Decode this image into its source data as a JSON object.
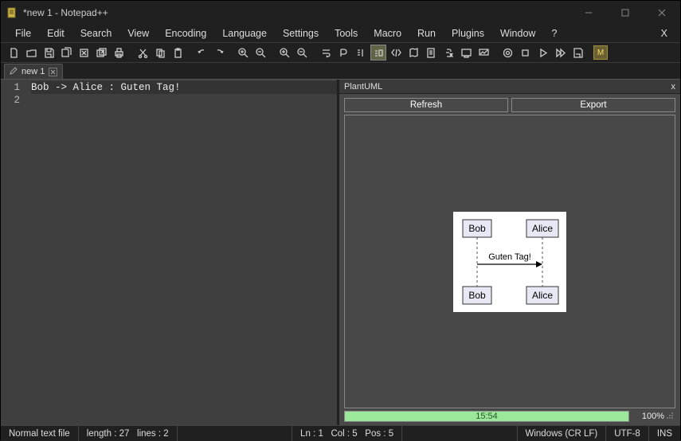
{
  "window": {
    "title": "*new 1 - Notepad++"
  },
  "menu": {
    "items": [
      "File",
      "Edit",
      "Search",
      "View",
      "Encoding",
      "Language",
      "Settings",
      "Tools",
      "Macro",
      "Run",
      "Plugins",
      "Window",
      "?"
    ]
  },
  "toolbar": {
    "left_icons": [
      "new",
      "open",
      "save",
      "save-all",
      "close",
      "close-all",
      "print"
    ],
    "edit_icons": [
      "cut",
      "copy",
      "paste"
    ],
    "undo_icons": [
      "undo",
      "redo"
    ],
    "zoom_icons": [
      "zoom-in",
      "zoom-out"
    ],
    "search_icons": [
      "find-start",
      "find-end"
    ],
    "record_icons": [
      "record",
      "play",
      "stop",
      "play-multi",
      "save-macro"
    ]
  },
  "tab": {
    "label": "new 1"
  },
  "editor": {
    "line1": "Bob -> Alice : Guten Tag!",
    "line_numbers": [
      "1",
      "2"
    ]
  },
  "panel": {
    "title": "PlantUML",
    "refresh": "Refresh",
    "export": "Export",
    "status_time": "15:54",
    "status_pct": "100%"
  },
  "diagram": {
    "left_actor": "Bob",
    "right_actor": "Alice",
    "message": "Guten Tag!"
  },
  "status": {
    "filetype": "Normal text file",
    "length_label": "length :",
    "length": "27",
    "lines_label": "lines :",
    "lines": "2",
    "ln_label": "Ln :",
    "ln": "1",
    "col_label": "Col :",
    "col": "5",
    "pos_label": "Pos :",
    "pos": "5",
    "eol": "Windows (CR LF)",
    "encoding": "UTF-8",
    "mode": "INS"
  },
  "chart_data": {
    "type": "sequence-diagram",
    "actors": [
      "Bob",
      "Alice"
    ],
    "messages": [
      {
        "from": "Bob",
        "to": "Alice",
        "label": "Guten Tag!"
      }
    ]
  }
}
